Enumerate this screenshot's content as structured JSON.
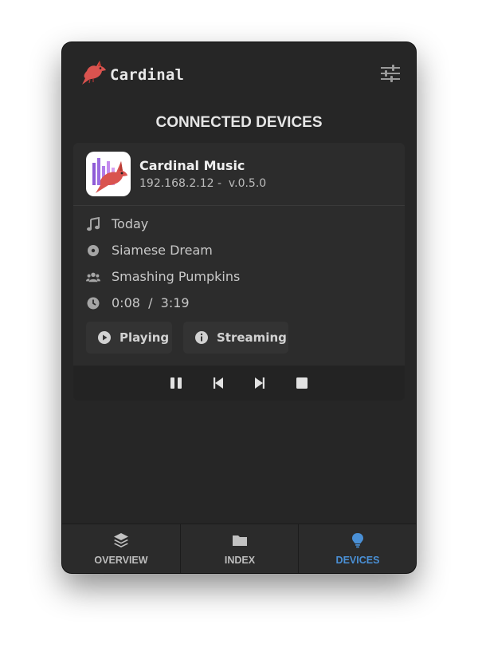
{
  "app": {
    "name": "Cardinal"
  },
  "section_title": "CONNECTED DEVICES",
  "device": {
    "name": "Cardinal Music",
    "meta": "192.168.2.12 -  v.0.5.0",
    "track": "Today",
    "album": "Siamese Dream",
    "artist": "Smashing Pumpkins",
    "time": "0:08  /  3:19",
    "status_label": "Playing",
    "mode_label": "Streaming"
  },
  "controls": [
    "pause",
    "previous",
    "next",
    "stop"
  ],
  "nav": {
    "items": [
      {
        "label": "OVERVIEW",
        "icon": "layers-icon"
      },
      {
        "label": "INDEX",
        "icon": "folder-icon"
      },
      {
        "label": "DEVICES",
        "icon": "lightbulb-icon",
        "active": true
      }
    ]
  },
  "colors": {
    "accent": "#4a90d6",
    "brand": "#d9534f",
    "background": "#262626"
  }
}
